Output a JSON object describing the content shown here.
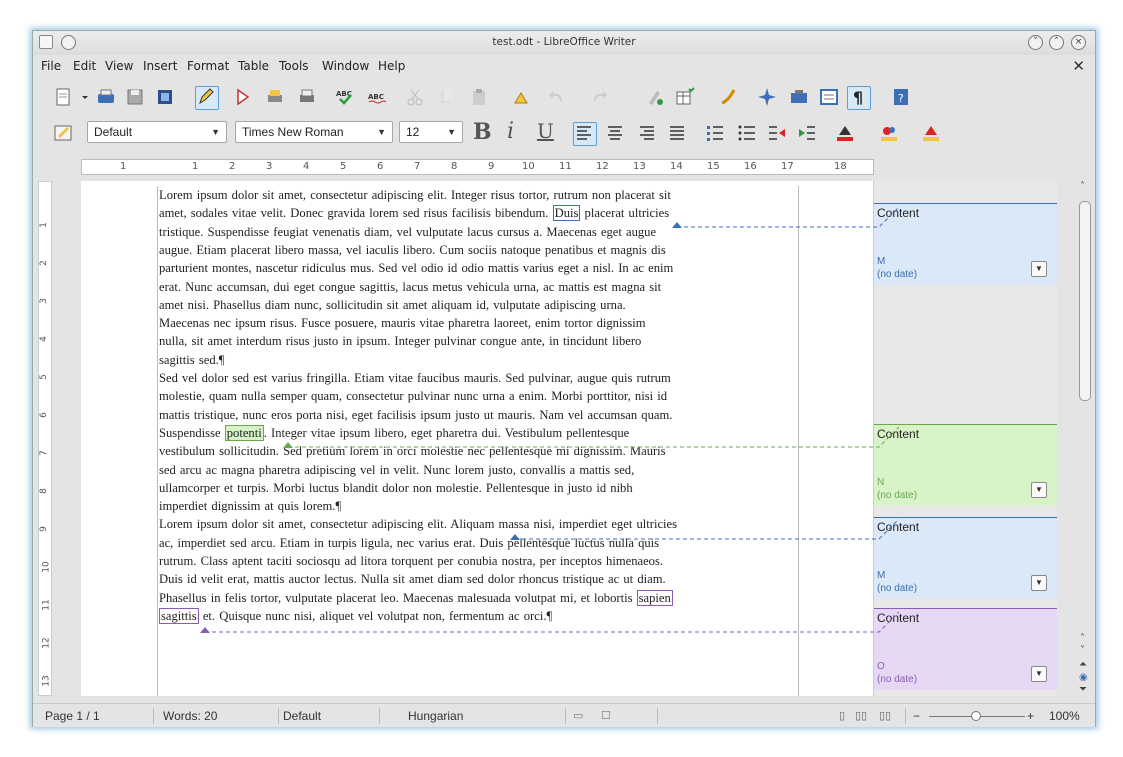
{
  "window": {
    "title": "test.odt - LibreOffice Writer"
  },
  "menu": [
    "File",
    "Edit",
    "View",
    "Insert",
    "Format",
    "Table",
    "Tools",
    "Window",
    "Help"
  ],
  "formatting": {
    "style": "Default",
    "font": "Times New Roman",
    "size": "12"
  },
  "ruler": {
    "h_numbers": [
      "1",
      "1",
      "2",
      "3",
      "4",
      "5",
      "6",
      "7",
      "8",
      "9",
      "10",
      "11",
      "12",
      "13",
      "14",
      "15",
      "16",
      "17",
      "18"
    ],
    "v_numbers": [
      "1",
      "2",
      "3",
      "4",
      "5",
      "6",
      "7",
      "8",
      "9",
      "10",
      "11",
      "12",
      "13"
    ]
  },
  "document": {
    "lines": [
      "Lorem ipsum dolor sit amet, consectetur adipiscing elit. Integer risus tortor, rutrum non placerat sit",
      "amet, sodales vitae velit. Donec gravida lorem sed risus facilisis bibendum. |Duis| placerat ultricies",
      "tristique. Suspendisse feugiat venenatis diam, vel vulputate lacus cursus a. Maecenas eget augue",
      "augue. Etiam placerat libero massa, vel iaculis libero. Cum sociis natoque penatibus et magnis dis",
      "parturient montes, nascetur ridiculus mus. Sed vel odio id odio mattis varius eget a nisl. In ac enim",
      "erat. Nunc accumsan, dui eget congue sagittis, lacus metus vehicula urna, ac mattis est magna sit",
      "amet nisi. Phasellus diam nunc, sollicitudin sit amet aliquam id, vulputate adipiscing urna.",
      "Maecenas nec ipsum risus. Fusce posuere, mauris vitae pharetra laoreet, enim tortor dignissim",
      "nulla, sit amet interdum risus justo in ipsum. Integer pulvinar congue ante, in tincidunt libero",
      "sagittis sed.¶",
      "Sed vel dolor sed est varius fringilla. Etiam vitae faucibus mauris. Sed pulvinar, augue quis rutrum",
      "molestie, quam nulla semper quam, consectetur pulvinar nunc urna a enim. Morbi porttitor, nisi id",
      "mattis tristique, nunc eros porta nisi, eget facilisis ipsum justo ut mauris. Nam vel accumsan quam.",
      "Suspendisse |potenti|. Integer vitae ipsum libero, eget pharetra dui. Vestibulum pellentesque",
      "vestibulum sollicitudin. Sed pretium lorem in orci molestie nec pellentesque mi dignissim. Mauris",
      "sed arcu ac magna pharetra adipiscing vel in velit. Nunc lorem justo, convallis a mattis sed,",
      "ullamcorper et turpis. Morbi luctus blandit dolor non molestie. Pellentesque in justo id nibh",
      "imperdiet dignissim at quis lorem.¶",
      "Lorem ipsum dolor sit amet, consectetur adipiscing elit. Aliquam massa nisi, imperdiet eget ultricies",
      "ac, imperdiet sed arcu. Etiam in turpis ligula, nec varius erat. Duis pellentesque luctus nulla quis",
      "rutrum. Class aptent taciti sociosqu ad litora torquent per conubia nostra, per inceptos himenaeos.",
      "Duis id velit erat, mattis auctor lectus. Nulla sit amet diam sed dolor rhoncus tristique ac ut diam.",
      "Phasellus in felis tortor, vulputate placerat leo. Maecenas malesuada volutpat mi, et lobortis |sapien",
      "sagittis| et. Quisque nunc nisi, aliquet vel volutpat non, fermentum ac orci.¶"
    ]
  },
  "comments": [
    {
      "content": "Content",
      "author": "M",
      "date": "(no date)",
      "color": "#dbe8f8",
      "border": "#3a6fb0"
    },
    {
      "content": "Content",
      "author": "N",
      "date": "(no date)",
      "color": "#d8f3c8",
      "border": "#6aa84f"
    },
    {
      "content": "Content",
      "author": "M",
      "date": "(no date)",
      "color": "#dbe8f8",
      "border": "#3a6fb0"
    },
    {
      "content": "Content",
      "author": "O",
      "date": "(no date)",
      "color": "#e6d8f3",
      "border": "#8c5bb8"
    }
  ],
  "status": {
    "page": "Page 1 / 1",
    "words": "Words: 20",
    "style": "Default",
    "language": "Hungarian",
    "zoom": "100%"
  }
}
